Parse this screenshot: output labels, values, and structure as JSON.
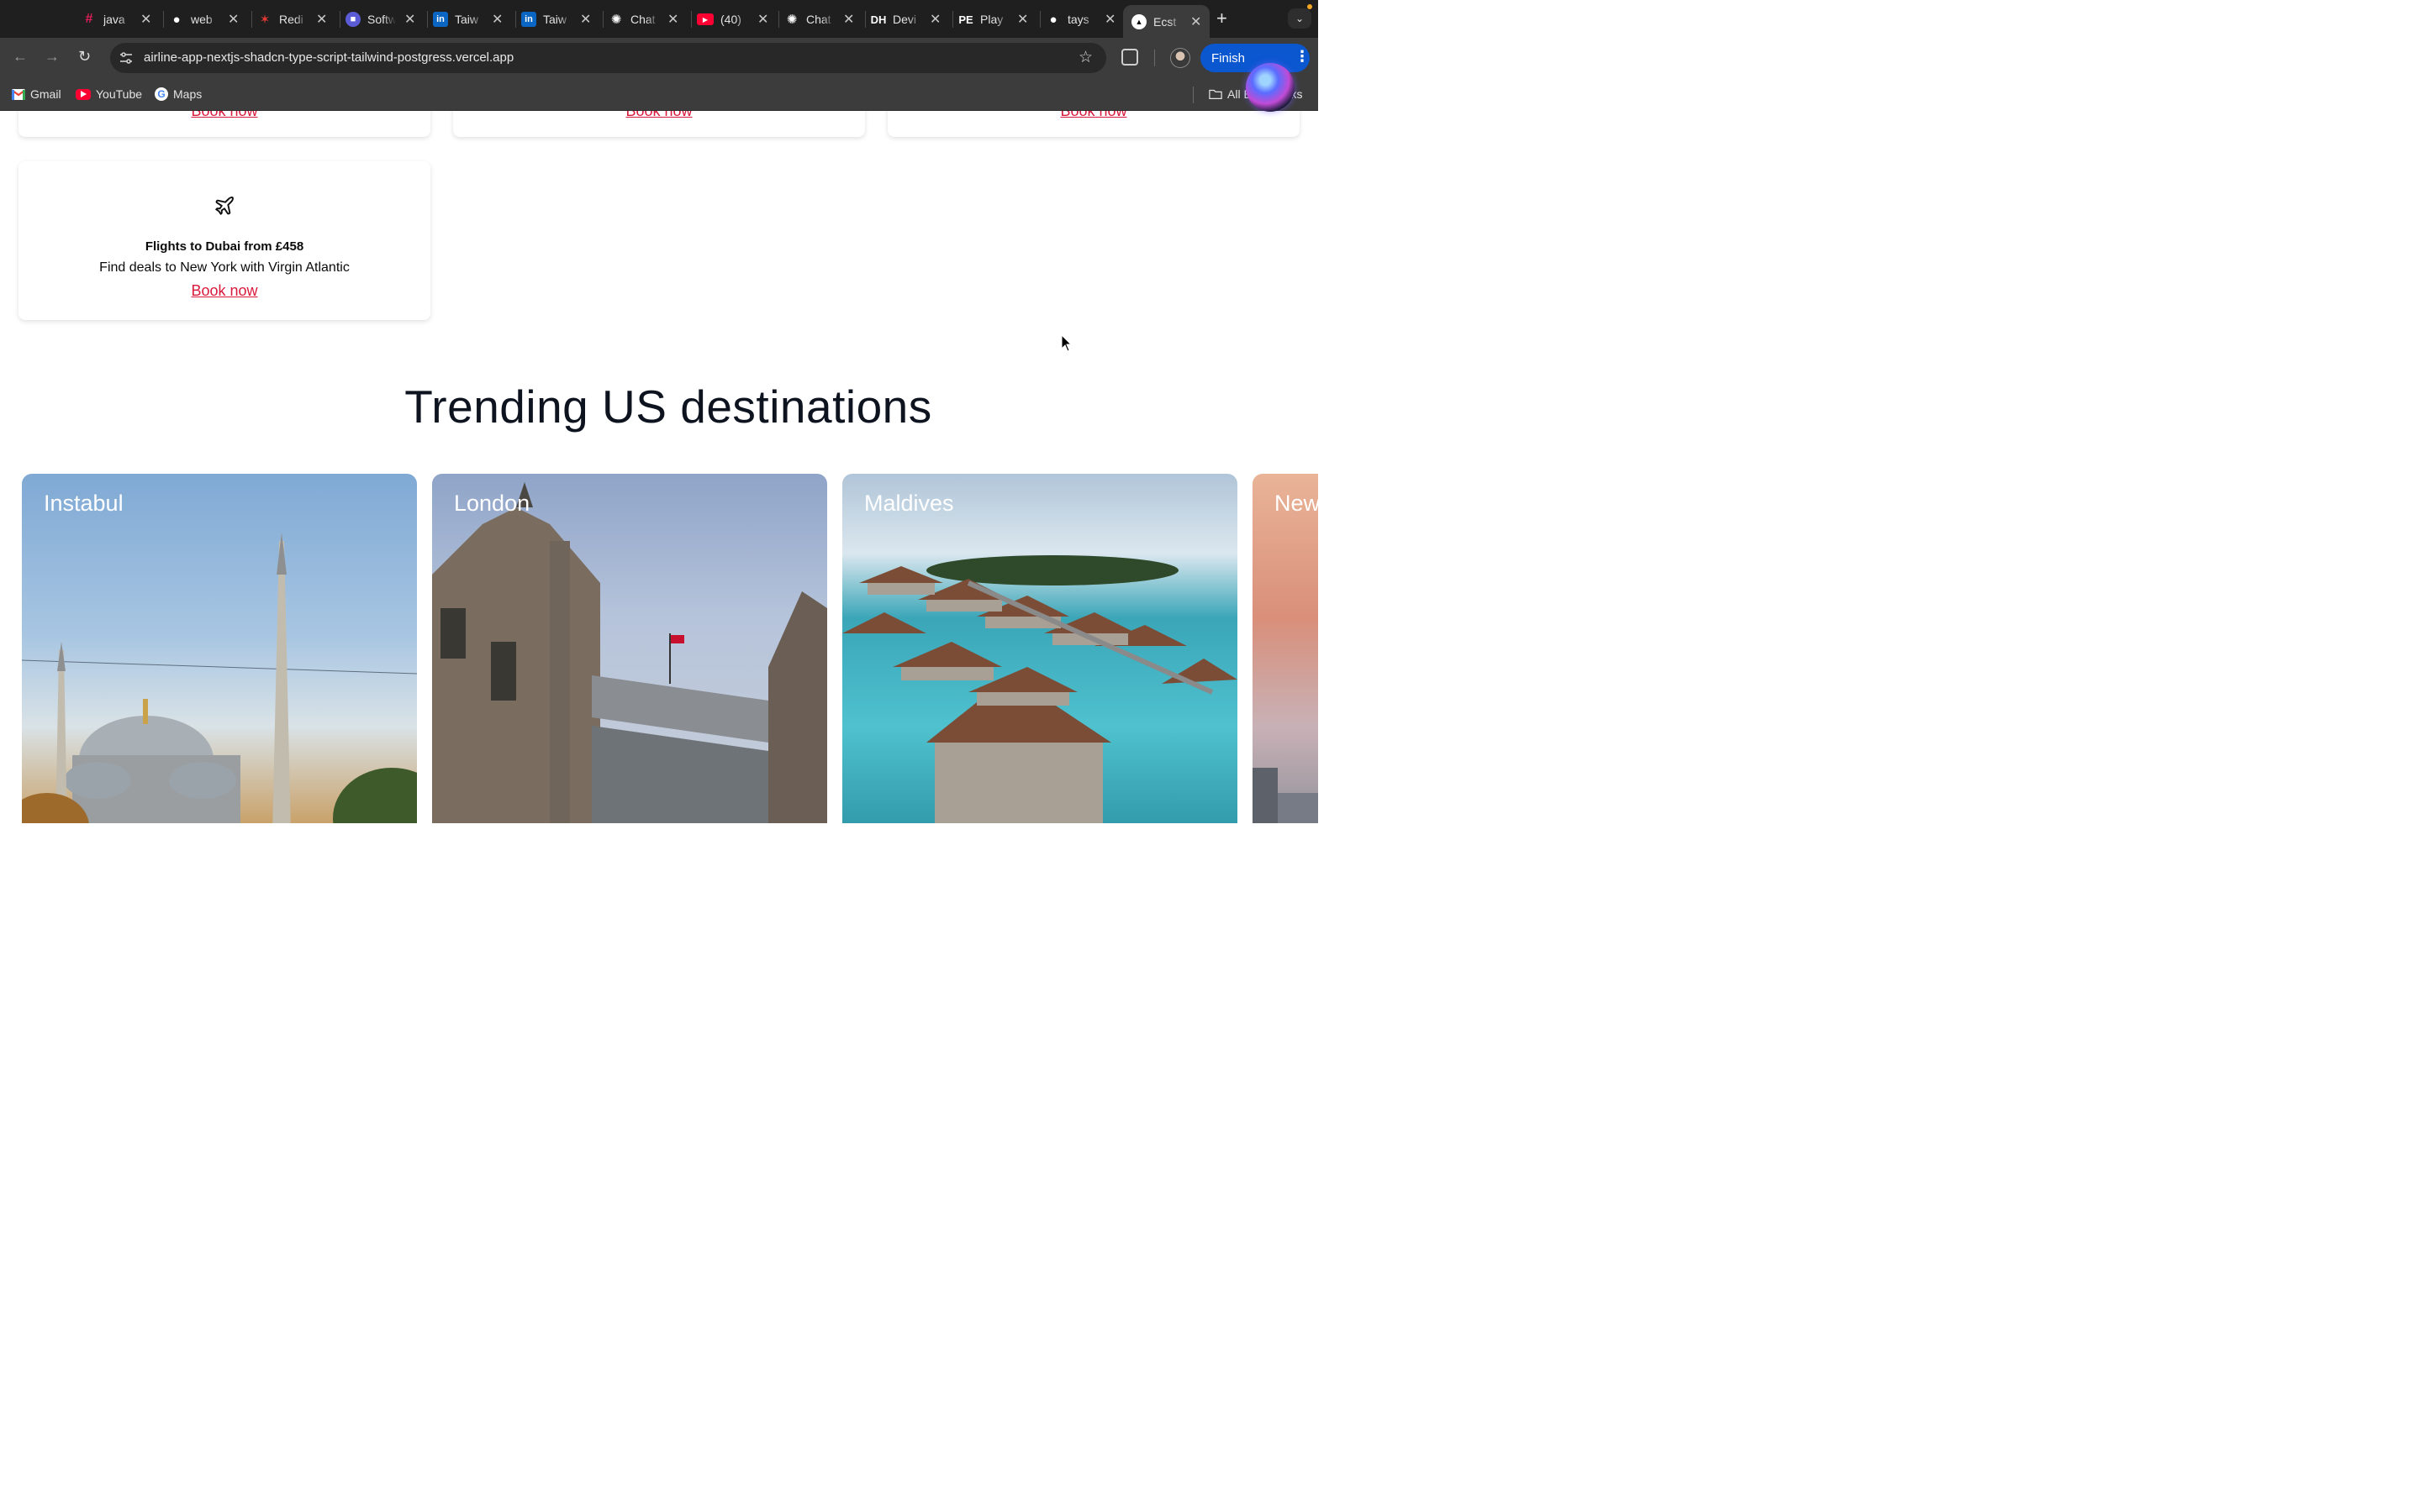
{
  "browser": {
    "tabs": [
      {
        "title": "java",
        "icon": "slack-icon",
        "color": "#611f69"
      },
      {
        "title": "web",
        "icon": "github-icon",
        "color": "#ffffff"
      },
      {
        "title": "Redi",
        "icon": "redis-icon",
        "color": "#e53935"
      },
      {
        "title": "Softw",
        "icon": "app-icon",
        "color": "#5b5bd6"
      },
      {
        "title": "Taiw",
        "icon": "linkedin-icon",
        "color": "#0a66c2"
      },
      {
        "title": "Taiw",
        "icon": "linkedin-icon",
        "color": "#0a66c2"
      },
      {
        "title": "Chat",
        "icon": "chatgpt-icon",
        "color": "#ffffff"
      },
      {
        "title": "(40)",
        "icon": "youtube-icon",
        "color": "#ff0033"
      },
      {
        "title": "Chat",
        "icon": "chatgpt-icon",
        "color": "#ffffff"
      },
      {
        "title": "Devi",
        "icon": "devhunt-icon",
        "color": "#ffffff"
      },
      {
        "title": "Play",
        "icon": "playground-icon",
        "color": "#ffffff"
      },
      {
        "title": "tays",
        "icon": "github-icon",
        "color": "#ffffff"
      },
      {
        "title": "Ecst",
        "icon": "vercel-icon",
        "color": "#ffffff",
        "active": true
      }
    ],
    "url": "airline-app-nextjs-shadcn-type-script-tailwind-postgress.vercel.app",
    "finish_label": "Finish",
    "bookmarks": [
      {
        "label": "Gmail",
        "icon": "gmail-icon"
      },
      {
        "label": "YouTube",
        "icon": "youtube-icon"
      },
      {
        "label": "Maps",
        "icon": "google-icon"
      }
    ],
    "all_bookmarks_label": "All Bookmarks"
  },
  "deals": {
    "top_row_links": [
      "Book now",
      "Book now",
      "Book now"
    ],
    "card": {
      "title": "Flights to Dubai from £458",
      "subtitle": "Find deals to New York with Virgin Atlantic",
      "link": "Book now"
    }
  },
  "trending": {
    "heading": "Trending US destinations",
    "destinations": [
      "Instabul",
      "London",
      "Maldives",
      "New"
    ]
  }
}
